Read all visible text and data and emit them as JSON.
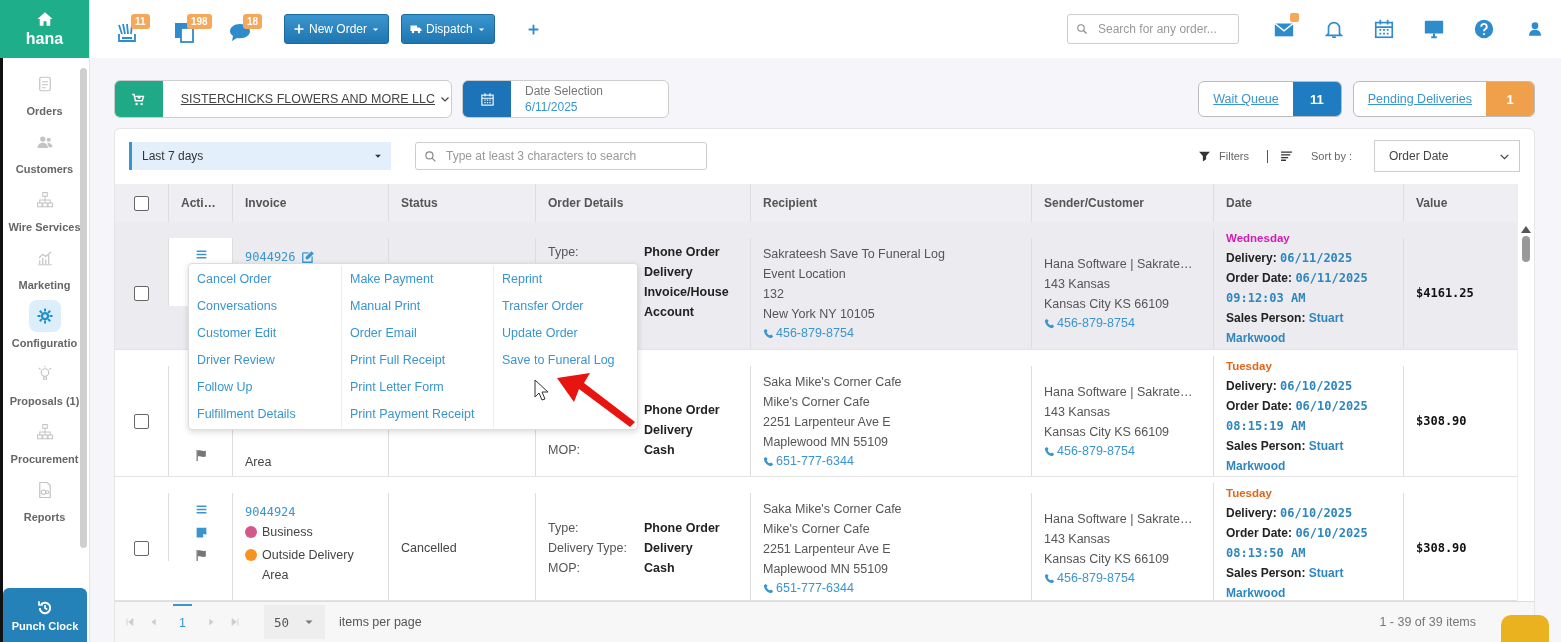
{
  "sidebar": {
    "brand": "hana",
    "items": [
      {
        "label": "Orders",
        "selected": false
      },
      {
        "label": "Customers",
        "selected": false
      },
      {
        "label": "Wire Services",
        "selected": false
      },
      {
        "label": "Marketing",
        "selected": false
      },
      {
        "label": "Configuratio",
        "selected": true
      },
      {
        "label": "Proposals (1)",
        "selected": false
      },
      {
        "label": "Procurement",
        "selected": false
      },
      {
        "label": "Reports",
        "selected": false
      }
    ],
    "punch_clock": "Punch Clock"
  },
  "topbar": {
    "counters": [
      "11",
      "198",
      "18"
    ],
    "new_order": "New Order",
    "dispatch": "Dispatch",
    "search": {
      "placeholder": "Search for any order..."
    },
    "mail_unread": true
  },
  "store": {
    "name": "SISTERCHICKS FLOWERS AND MORE LLC"
  },
  "date_selection": {
    "label": "Date Selection",
    "value": "6/11/2025"
  },
  "queues": [
    {
      "label": "Wait Queue",
      "count": "11",
      "color": "#1f7cc1"
    },
    {
      "label": "Pending Deliveries",
      "count": "1",
      "color": "#f0a04b"
    }
  ],
  "filters": {
    "range": "Last 7 days",
    "search": {
      "placeholder": "Type at least 3 characters to search"
    },
    "filters_label": "Filters",
    "sort_label": "Sort by :",
    "sort_value": "Order Date"
  },
  "table": {
    "all_checked": false,
    "columns": [
      "Acti…",
      "Invoice",
      "Status",
      "Order Details",
      "Recipient",
      "Sender/Customer",
      "Date",
      "Value"
    ],
    "rows": [
      {
        "selected": true,
        "checked": false,
        "actions": [
          {
            "kind": "menu"
          }
        ],
        "invoice": {
          "number": "9044926",
          "editable": true
        },
        "tags": [],
        "details": [
          {
            "label": "Type:",
            "value": "Phone Order"
          },
          {
            "value": "Delivery"
          },
          {
            "value": "Invoice/House Account"
          }
        ],
        "recipient": {
          "lines": [
            "Sakrateesh Save To Funeral Log",
            "Event Location",
            "132",
            "New York NY 10105"
          ],
          "phone": "456-879-8754"
        },
        "sender": {
          "lines": [
            "Hana Software | Sakrate…",
            "143 Kansas",
            "Kansas City KS 66109"
          ],
          "phone": "456-879-8754"
        },
        "date": {
          "day": "Wednesday",
          "color": "#d21bb5",
          "delivery_label": "Delivery:",
          "delivery": "06/11/2025",
          "order_label": "Order Date:",
          "order_date": "06/11/2025",
          "order_time": "09:12:03 AM",
          "sales_label": "Sales Person:",
          "sales_person": "Stuart Markwood"
        },
        "value": "$4161.25"
      },
      {
        "selected": false,
        "checked": false,
        "actions": [
          {
            "kind": "flag"
          }
        ],
        "tags": [
          {
            "text": "Area"
          }
        ],
        "details": [
          {
            "value": "Phone Order"
          },
          {
            "value": "Delivery"
          },
          {
            "label": "MOP:",
            "value": "Cash"
          }
        ],
        "recipient": {
          "lines": [
            "Saka Mike's Corner Cafe",
            "Mike's Corner Cafe",
            "2251 Larpenteur Ave E",
            "Maplewood MN 55109"
          ],
          "phone": "651-777-6344"
        },
        "sender": {
          "lines": [
            "Hana Software | Sakrate…",
            "143 Kansas",
            "Kansas City KS 66109"
          ],
          "phone": "456-879-8754"
        },
        "date": {
          "day": "Tuesday",
          "color": "#e0661a",
          "delivery_label": "Delivery:",
          "delivery": "06/10/2025",
          "order_label": "Order Date:",
          "order_date": "06/10/2025",
          "order_time": "08:15:19 AM",
          "sales_label": "Sales Person:",
          "sales_person": "Stuart Markwood"
        },
        "value": "$308.90"
      },
      {
        "selected": false,
        "checked": false,
        "actions": [
          {
            "kind": "menu"
          },
          {
            "kind": "note"
          },
          {
            "kind": "flag"
          }
        ],
        "invoice": {
          "number": "9044924",
          "editable": false
        },
        "tags": [
          {
            "text": "Business",
            "color": "#d4578a"
          },
          {
            "text": "Outside Delivery Area",
            "color": "#f7931e"
          }
        ],
        "status": "Cancelled",
        "details": [
          {
            "label": "Type:",
            "value": "Phone Order"
          },
          {
            "label": "Delivery Type:",
            "value": "Delivery"
          },
          {
            "label": "MOP:",
            "value": "Cash"
          }
        ],
        "recipient": {
          "lines": [
            "Saka Mike's Corner Cafe",
            "Mike's Corner Cafe",
            "2251 Larpenteur Ave E",
            "Maplewood MN 55109"
          ],
          "phone": "651-777-6344"
        },
        "sender": {
          "lines": [
            "Hana Software | Sakrate…",
            "143 Kansas",
            "Kansas City KS 66109"
          ],
          "phone": "456-879-8754"
        },
        "date": {
          "day": "Tuesday",
          "color": "#e0661a",
          "delivery_label": "Delivery:",
          "delivery": "06/10/2025",
          "order_label": "Order Date:",
          "order_date": "06/10/2025",
          "order_time": "08:13:50 AM",
          "sales_label": "Sales Person:",
          "sales_person": "Stuart Markwood"
        },
        "value": "$308.90"
      }
    ]
  },
  "action_menu": {
    "columns": [
      [
        "Cancel Order",
        "Conversations",
        "Customer Edit",
        "Driver Review",
        "Follow Up",
        "Fulfillment Details"
      ],
      [
        "Make Payment",
        "Manual Print",
        "Order Email",
        "Print Full Receipt",
        "Print Letter Form",
        "Print Payment Receipt"
      ],
      [
        "Reprint",
        "Transfer Order",
        "Update Order",
        "Save to Funeral Log"
      ]
    ]
  },
  "pager": {
    "page": "1",
    "page_size": "50",
    "per_page_label": "items per page",
    "summary": "1 - 39 of 39 items"
  }
}
